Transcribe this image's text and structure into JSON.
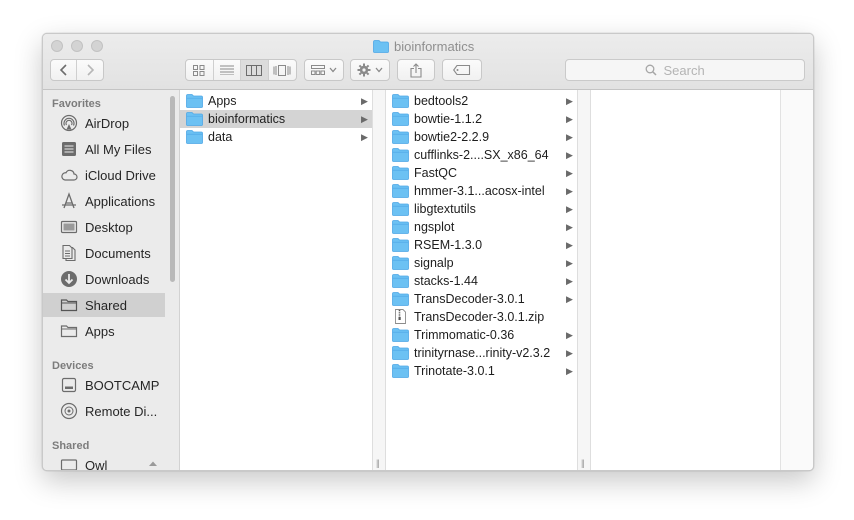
{
  "window": {
    "title": "bioinformatics"
  },
  "toolbar": {
    "search_placeholder": "Search"
  },
  "sidebar": {
    "sections": [
      {
        "header": "Favorites",
        "items": [
          {
            "label": "AirDrop",
            "icon": "airdrop-icon"
          },
          {
            "label": "All My Files",
            "icon": "all-files-icon"
          },
          {
            "label": "iCloud Drive",
            "icon": "cloud-icon"
          },
          {
            "label": "Applications",
            "icon": "applications-icon"
          },
          {
            "label": "Desktop",
            "icon": "desktop-icon"
          },
          {
            "label": "Documents",
            "icon": "documents-icon"
          },
          {
            "label": "Downloads",
            "icon": "downloads-icon"
          },
          {
            "label": "Shared",
            "icon": "folder-icon",
            "selected": true
          },
          {
            "label": "Apps",
            "icon": "folder-icon"
          }
        ]
      },
      {
        "header": "Devices",
        "items": [
          {
            "label": "BOOTCAMP",
            "icon": "disk-icon"
          },
          {
            "label": "Remote Di...",
            "icon": "remote-disc-icon"
          }
        ]
      },
      {
        "header": "Shared",
        "items": [
          {
            "label": "Owl",
            "icon": "network-computer-icon"
          }
        ]
      }
    ]
  },
  "columns": [
    {
      "items": [
        {
          "name": "Apps",
          "folder": true
        },
        {
          "name": "bioinformatics",
          "folder": true,
          "selected": true
        },
        {
          "name": "data",
          "folder": true
        }
      ]
    },
    {
      "items": [
        {
          "name": "bedtools2",
          "folder": true
        },
        {
          "name": "bowtie-1.1.2",
          "folder": true
        },
        {
          "name": "bowtie2-2.2.9",
          "folder": true
        },
        {
          "name": "cufflinks-2....SX_x86_64",
          "folder": true
        },
        {
          "name": "FastQC",
          "folder": true
        },
        {
          "name": "hmmer-3.1...acosx-intel",
          "folder": true
        },
        {
          "name": "libgtextutils",
          "folder": true
        },
        {
          "name": "ngsplot",
          "folder": true
        },
        {
          "name": "RSEM-1.3.0",
          "folder": true
        },
        {
          "name": "signalp",
          "folder": true
        },
        {
          "name": "stacks-1.44",
          "folder": true
        },
        {
          "name": "TransDecoder-3.0.1",
          "folder": true
        },
        {
          "name": "TransDecoder-3.0.1.zip",
          "folder": false
        },
        {
          "name": "Trimmomatic-0.36",
          "folder": true
        },
        {
          "name": "trinityrnase...rinity-v2.3.2",
          "folder": true
        },
        {
          "name": "Trinotate-3.0.1",
          "folder": true
        }
      ]
    }
  ],
  "colors": {
    "folder": "#6cc1f3",
    "folder_tab": "#4ea7e6",
    "selection": "#d4d4d4"
  }
}
